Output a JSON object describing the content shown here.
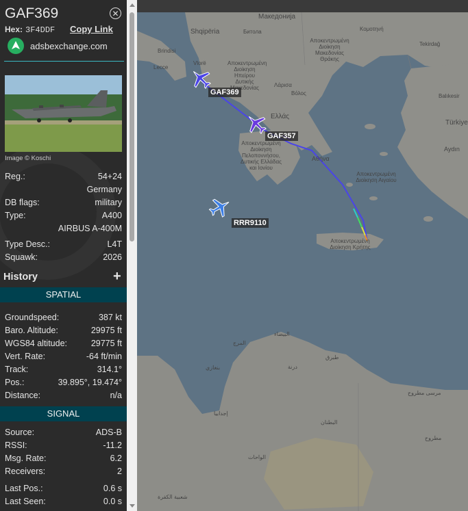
{
  "aircraft": {
    "callsign": "GAF369",
    "hex_label": "Hex:",
    "hex": "3F4DDF",
    "copy_link": "Copy Link",
    "close_icon": "close-icon",
    "source_link": "adsbexchange.com"
  },
  "photo": {
    "credit": "Image © Koschi"
  },
  "details": [
    {
      "key": "Reg.:",
      "value": "54+24"
    },
    {
      "key": "",
      "value": "Germany"
    },
    {
      "key": "DB flags:",
      "value": "military"
    },
    {
      "key": "Type:",
      "value": "A400"
    },
    {
      "key": "",
      "value": "AIRBUS A-400M"
    },
    {
      "key": "Type Desc.:",
      "value": "L4T"
    },
    {
      "key": "Squawk:",
      "value": "2026"
    }
  ],
  "history": {
    "label": "History",
    "expand_icon": "plus-icon"
  },
  "spatial": {
    "title": "SPATIAL",
    "rows": [
      {
        "key": "Groundspeed:",
        "value": "387 kt"
      },
      {
        "key": "Baro. Altitude:",
        "value": "29975 ft"
      },
      {
        "key": "WGS84 altitude:",
        "value": "29775 ft"
      },
      {
        "key": "Vert. Rate:",
        "value": "-64 ft/min"
      },
      {
        "key": "Track:",
        "value": "314.1°"
      },
      {
        "key": "Pos.:",
        "value": "39.895°, 19.474°"
      },
      {
        "key": "Distance:",
        "value": "n/a"
      }
    ]
  },
  "signal": {
    "title": "SIGNAL",
    "rows": [
      {
        "key": "Source:",
        "value": "ADS-B"
      },
      {
        "key": "RSSI:",
        "value": "-11.2"
      },
      {
        "key": "Msg. Rate:",
        "value": "6.2"
      },
      {
        "key": "Receivers:",
        "value": "2"
      },
      {
        "key": "Last Pos.:",
        "value": "0.6 s"
      },
      {
        "key": "Last Seen:",
        "value": "0.0 s"
      }
    ]
  },
  "map": {
    "planes": [
      {
        "callsign": "GAF369",
        "color": "#4a44e8",
        "selected": true
      },
      {
        "callsign": "GAF357",
        "color": "#6a3ae0",
        "selected": false
      },
      {
        "callsign": "RRR9110",
        "color": "#3d7fe6",
        "selected": false
      }
    ],
    "places": [
      {
        "name": "Македонија"
      },
      {
        "name": "Shqipëria"
      },
      {
        "name": "Битола"
      },
      {
        "name": "Κομοτηνή"
      },
      {
        "name": "Tekirdağ"
      },
      {
        "name": "Αποκεντρωμένη Διοίκηση Μακεδονίας Θράκης"
      },
      {
        "name": "Vlorë"
      },
      {
        "name": "Brindisi"
      },
      {
        "name": "Lecce"
      },
      {
        "name": "Αποκεντρωμένη Διοίκηση Ηπείρου Δυτικής Μακεδονίας"
      },
      {
        "name": "Λάρισα"
      },
      {
        "name": "Βόλος"
      },
      {
        "name": "Ελλάς"
      },
      {
        "name": "Balıkesir"
      },
      {
        "name": "Türkiye"
      },
      {
        "name": "Αποκεντρωμένη Διοίκηση Πελοποννήσου, Δυτικής Ελλάδας και Ιονίου"
      },
      {
        "name": "Αθήνα"
      },
      {
        "name": "Aydın"
      },
      {
        "name": "Αποκεντρωμένη Διοίκηση Αιγαίου"
      },
      {
        "name": "Αποκεντρωμένη Διοίκηση Κρήτης"
      },
      {
        "name": "البيضاء"
      },
      {
        "name": "المرج"
      },
      {
        "name": "بنغازي"
      },
      {
        "name": "درنة"
      },
      {
        "name": "طبرق"
      },
      {
        "name": "مرسى مطروح"
      },
      {
        "name": "إجدابيا"
      },
      {
        "name": "البطنان"
      },
      {
        "name": "مطروح"
      },
      {
        "name": "الواحات"
      },
      {
        "name": "شعبية الكفرة"
      }
    ]
  },
  "colors": {
    "sidebar_bg": "#2b2b2b",
    "section_bar": "#00414f",
    "accent_line": "#3ab8c2",
    "track_line": "#4a44e8"
  }
}
